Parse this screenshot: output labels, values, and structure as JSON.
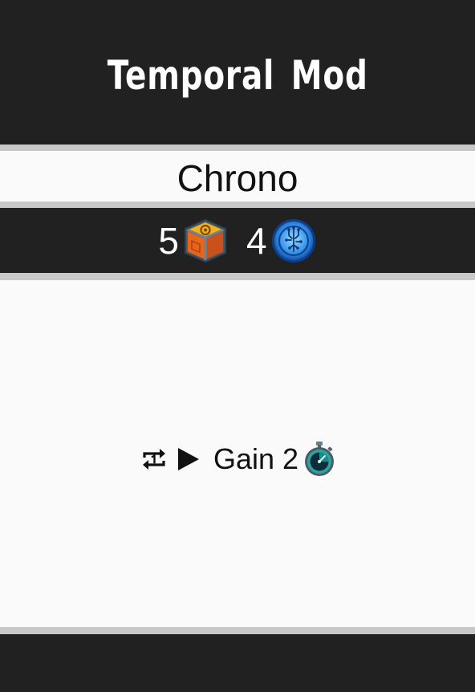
{
  "card": {
    "title": "Temporal Mod",
    "subtype": "Chrono",
    "cost": [
      {
        "amount": "5",
        "icon": "material-crate-icon"
      },
      {
        "amount": "4",
        "icon": "circuit-energy-icon"
      }
    ],
    "ability": {
      "trigger_icon": "repeat-once-icon",
      "arrow_icon": "play-arrow-icon",
      "text": "Gain",
      "amount": "2",
      "reward_icon": "stopwatch-icon"
    }
  },
  "colors": {
    "dark_band": "#212121",
    "light_panel": "#fafafa",
    "separator": "#c8c8c8",
    "crate_orange": "#e8651a",
    "crate_gold": "#f2b21c",
    "circuit_blue": "#1e78d8",
    "stopwatch_teal": "#2aa6a0"
  }
}
